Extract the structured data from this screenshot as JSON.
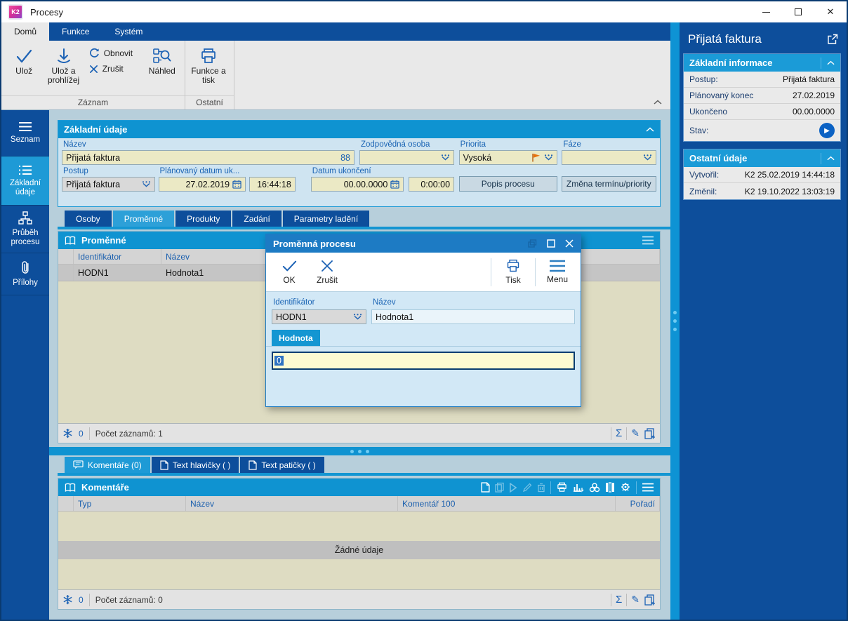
{
  "window": {
    "title": "Procesy",
    "logo_text": "K2"
  },
  "icons": {
    "close": "✕",
    "sum": "Σ",
    "pencil": "✎",
    "play": "▶"
  },
  "colors": {
    "dark_blue": "#0d4e9b",
    "bright_blue": "#0f93d1",
    "active_blue": "#1e9ad6",
    "khaki_field": "#ebe9c5",
    "selection_blue": "#2e72c2",
    "flag_orange": "#e8720c",
    "dialog_title_blue": "#1d7bc4"
  },
  "ribbon": {
    "tabs": [
      {
        "label": "Domů",
        "active": true
      },
      {
        "label": "Funkce",
        "active": false
      },
      {
        "label": "Systém",
        "active": false
      }
    ],
    "save": "Ulož",
    "save_and_view": "Ulož a prohlížej",
    "refresh": "Obnovit",
    "cancel": "Zrušit",
    "preview": "Náhled",
    "function_print": "Funkce a tisk",
    "group_record": "Záznam",
    "group_other": "Ostatní"
  },
  "sidebar": {
    "items": [
      {
        "label": "Seznam",
        "icon": "menu-icon",
        "active": false
      },
      {
        "label": "Základní údaje",
        "icon": "list-icon",
        "active": true
      },
      {
        "label": "Průběh procesu",
        "icon": "hierarchy-icon",
        "active": false
      },
      {
        "label": "Přílohy",
        "icon": "paperclip-icon",
        "active": false
      }
    ]
  },
  "basic_panel": {
    "title": "Základní údaje",
    "nazev_label": "Název",
    "nazev_value": "Přijatá faktura",
    "nazev_number": "88",
    "osoba_label": "Zodpovědná osoba",
    "osoba_value": "",
    "priorita_label": "Priorita",
    "priorita_value": "Vysoká",
    "faze_label": "Fáze",
    "faze_value": "",
    "postup_label": "Postup",
    "postup_value": "Přijatá faktura",
    "plan_label": "Plánovaný datum uk...",
    "plan_date": "27.02.2019",
    "plan_time": "16:44:18",
    "konec_label": "Datum ukončení",
    "konec_date": "00.00.0000",
    "konec_time": "0:00:00",
    "btn_popis": "Popis procesu",
    "btn_zmena": "Změna termínu/priority"
  },
  "detail_tabs": [
    {
      "label": "Osoby",
      "active": false
    },
    {
      "label": "Proměnné",
      "active": true
    },
    {
      "label": "Produkty",
      "active": false
    },
    {
      "label": "Zadání",
      "active": false
    },
    {
      "label": "Parametry ladění",
      "active": false
    }
  ],
  "variables_panel": {
    "title": "Proměnné",
    "columns": [
      "Identifikátor",
      "Název"
    ],
    "rows": [
      {
        "id": "HODN1",
        "name": "Hodnota1"
      }
    ],
    "filter_count": "0",
    "records_text": "Počet záznamů: 1"
  },
  "dialog": {
    "title": "Proměnná procesu",
    "ok": "OK",
    "cancel": "Zrušit",
    "print": "Tisk",
    "menu": "Menu",
    "id_label": "Identifikátor",
    "id_value": "HODN1",
    "name_label": "Název",
    "name_value": "Hodnota1",
    "tab": "Hodnota",
    "value": "0"
  },
  "comment_tabs": [
    {
      "label": "Komentáře (0)",
      "active": true
    },
    {
      "label": "Text hlavičky ( )",
      "active": false
    },
    {
      "label": "Text patičky ( )",
      "active": false
    }
  ],
  "comments_panel": {
    "title": "Komentáře",
    "columns": [
      "Typ",
      "Název",
      "Komentář 100",
      "Pořadí"
    ],
    "empty_text": "Žádné údaje",
    "filter_count": "0",
    "records_text": "Počet záznamů: 0"
  },
  "info_panel": {
    "title": "Přijatá faktura",
    "sections": [
      {
        "title": "Základní informace",
        "rows": [
          {
            "label": "Postup:",
            "value": "Přijatá faktura"
          },
          {
            "label": "Plánovaný konec",
            "value": "27.02.2019"
          },
          {
            "label": "Ukončeno",
            "value": "00.00.0000"
          },
          {
            "label": "Stav:",
            "value": ""
          }
        ]
      },
      {
        "title": "Ostatní údaje",
        "rows": [
          {
            "label": "Vytvořil:",
            "value": "K2 25.02.2019 14:44:18"
          },
          {
            "label": "Změnil:",
            "value": "K2 19.10.2022 13:03:19"
          }
        ]
      }
    ]
  }
}
